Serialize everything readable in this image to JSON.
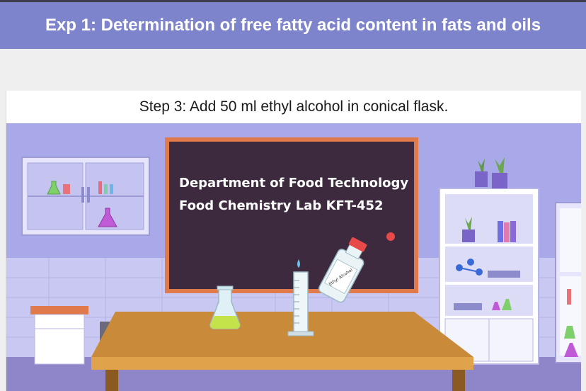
{
  "header": {
    "title": "Exp 1: Determination of free fatty acid content in fats and oils"
  },
  "step": {
    "text": "Step 3: Add 50 ml ethyl alcohol in conical flask."
  },
  "board": {
    "line1": "Department of Food Technology",
    "line2": "Food Chemistry Lab  KFT-452"
  },
  "bottle": {
    "label": "Ethyl Alcohol"
  },
  "colors": {
    "header": "#7d84cc",
    "wall": "#a9a8e8",
    "board": "#3e2a3f",
    "table": "#c98a3a"
  }
}
